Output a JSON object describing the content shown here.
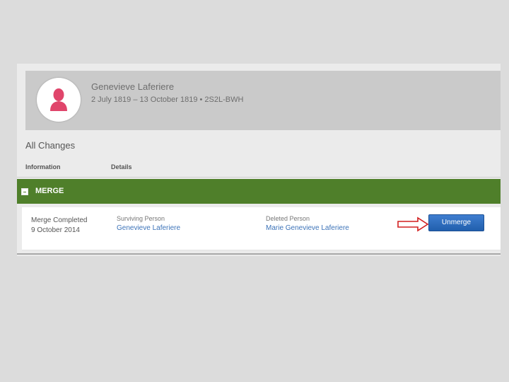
{
  "person": {
    "name": "Genevieve Laferiere",
    "life_span_id": "2 July 1819 – 13 October 1819 • 2S2L-BWH"
  },
  "changes": {
    "title": "All Changes",
    "columns": {
      "information": "Information",
      "details": "Details"
    }
  },
  "merge": {
    "section_label": "MERGE",
    "status": "Merge Completed",
    "date": "9 October 2014",
    "surviving_label": "Surviving Person",
    "surviving_name": "Genevieve Laferiere",
    "deleted_label": "Deleted Person",
    "deleted_name": "Marie Genevieve Laferiere",
    "unmerge_label": "Unmerge"
  },
  "colors": {
    "merge_bar": "#4f7f2a",
    "link": "#3c73b8",
    "button": "#215fad",
    "avatar_icon": "#e0456b",
    "arrow": "#d21f1f"
  }
}
